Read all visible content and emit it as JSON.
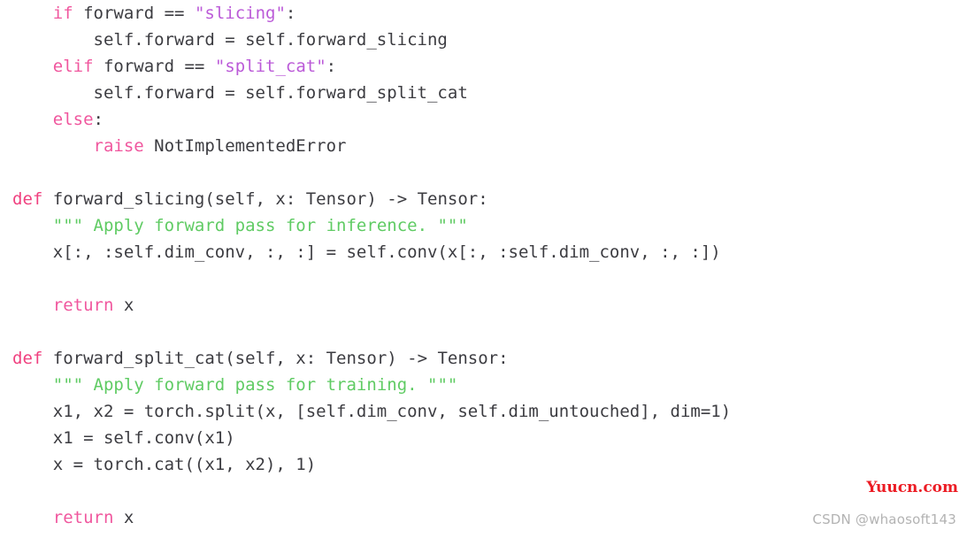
{
  "editor": {
    "language": "python",
    "background_color": "#ffffff",
    "plain_text_color": "#3c3c41",
    "keyword_color": "#f0579e",
    "def_keyword_color": "#f0407f",
    "string_color": "#bb5ad8",
    "docstring_color": "#5fcb63"
  },
  "code": {
    "lines": [
      {
        "id": "line-1",
        "tokens": [
          {
            "text": "    ",
            "kind": "plain"
          },
          {
            "text": "if",
            "kind": "kw"
          },
          {
            "text": " forward == ",
            "kind": "plain"
          },
          {
            "text": "\"slicing\"",
            "kind": "str"
          },
          {
            "text": ":",
            "kind": "plain"
          }
        ]
      },
      {
        "id": "line-2",
        "tokens": [
          {
            "text": "        self.forward = self.forward_slicing",
            "kind": "plain"
          }
        ]
      },
      {
        "id": "line-3",
        "tokens": [
          {
            "text": "    ",
            "kind": "plain"
          },
          {
            "text": "elif",
            "kind": "kw"
          },
          {
            "text": " forward == ",
            "kind": "plain"
          },
          {
            "text": "\"split_cat\"",
            "kind": "str"
          },
          {
            "text": ":",
            "kind": "plain"
          }
        ]
      },
      {
        "id": "line-4",
        "tokens": [
          {
            "text": "        self.forward = self.forward_split_cat",
            "kind": "plain"
          }
        ]
      },
      {
        "id": "line-5",
        "tokens": [
          {
            "text": "    ",
            "kind": "plain"
          },
          {
            "text": "else",
            "kind": "kw"
          },
          {
            "text": ":",
            "kind": "plain"
          }
        ]
      },
      {
        "id": "line-6",
        "tokens": [
          {
            "text": "        ",
            "kind": "plain"
          },
          {
            "text": "raise",
            "kind": "kw"
          },
          {
            "text": " NotImplementedError",
            "kind": "plain"
          }
        ]
      },
      {
        "id": "line-7",
        "tokens": []
      },
      {
        "id": "line-8",
        "tokens": [
          {
            "text": "def",
            "kind": "def"
          },
          {
            "text": " forward_slicing(self, x: Tensor) -> Tensor:",
            "kind": "plain"
          }
        ]
      },
      {
        "id": "line-9",
        "tokens": [
          {
            "text": "    ",
            "kind": "plain"
          },
          {
            "text": "\"\"\" Apply forward pass for inference. \"\"\"",
            "kind": "doc"
          }
        ]
      },
      {
        "id": "line-10",
        "tokens": [
          {
            "text": "    x[:, :self.dim_conv, :, :] = self.conv(x[:, :self.dim_conv, :, :])",
            "kind": "plain"
          }
        ]
      },
      {
        "id": "line-11",
        "tokens": []
      },
      {
        "id": "line-12",
        "tokens": [
          {
            "text": "    ",
            "kind": "plain"
          },
          {
            "text": "return",
            "kind": "kw"
          },
          {
            "text": " x",
            "kind": "plain"
          }
        ]
      },
      {
        "id": "line-13",
        "tokens": []
      },
      {
        "id": "line-14",
        "tokens": [
          {
            "text": "def",
            "kind": "def"
          },
          {
            "text": " forward_split_cat(self, x: Tensor) -> Tensor:",
            "kind": "plain"
          }
        ]
      },
      {
        "id": "line-15",
        "tokens": [
          {
            "text": "    ",
            "kind": "plain"
          },
          {
            "text": "\"\"\" Apply forward pass for training. \"\"\"",
            "kind": "doc"
          }
        ]
      },
      {
        "id": "line-16",
        "tokens": [
          {
            "text": "    x1, x2 = torch.split(x, [self.dim_conv, self.dim_untouched], dim=1)",
            "kind": "plain"
          }
        ]
      },
      {
        "id": "line-17",
        "tokens": [
          {
            "text": "    x1 = self.conv(x1)",
            "kind": "plain"
          }
        ]
      },
      {
        "id": "line-18",
        "tokens": [
          {
            "text": "    x = torch.cat((x1, x2), 1)",
            "kind": "plain"
          }
        ]
      },
      {
        "id": "line-19",
        "tokens": []
      },
      {
        "id": "line-20",
        "tokens": [
          {
            "text": "    ",
            "kind": "plain"
          },
          {
            "text": "return",
            "kind": "kw"
          },
          {
            "text": " x",
            "kind": "plain"
          }
        ]
      }
    ]
  },
  "watermarks": {
    "primary": "Yuucn.com",
    "primary_color": "#ec1c24",
    "secondary": "CSDN @whaosoft143",
    "secondary_color": "#b3b3b3"
  }
}
